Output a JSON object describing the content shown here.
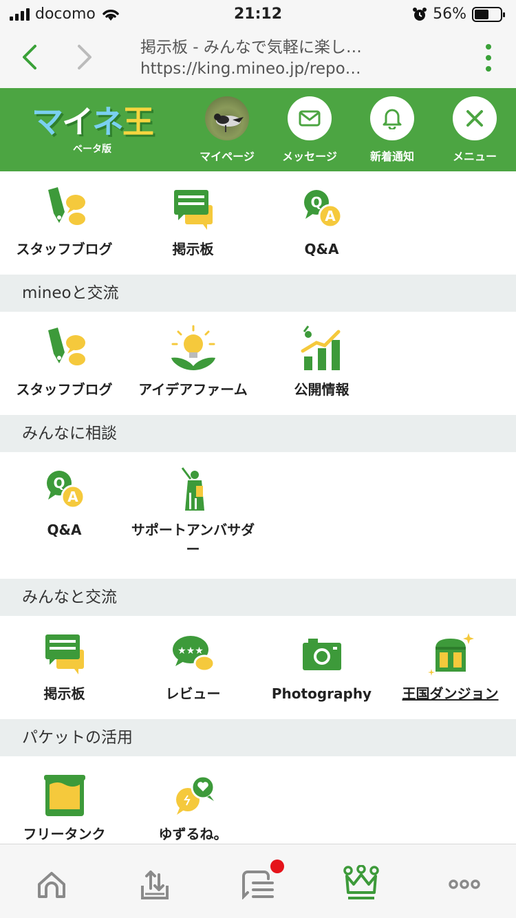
{
  "status_bar": {
    "carrier": "docomo",
    "time": "21:12",
    "battery": "56%"
  },
  "browser": {
    "page_title": "掲示板 - みんなで気軽に楽し…",
    "url": "https://king.mineo.jp/repo…"
  },
  "header": {
    "logo_text": [
      "マ",
      "イ",
      "ネ",
      "王"
    ],
    "beta_label": "ベータ版",
    "items": [
      {
        "label": "マイページ",
        "icon": "avatar"
      },
      {
        "label": "メッセージ",
        "icon": "envelope-icon"
      },
      {
        "label": "新着通知",
        "icon": "bell-icon"
      },
      {
        "label": "メニュー",
        "icon": "close-icon"
      }
    ]
  },
  "top_row": [
    {
      "label": "スタッフブログ",
      "icon": "staff-blog-icon"
    },
    {
      "label": "掲示板",
      "icon": "board-icon"
    },
    {
      "label": "Q&A",
      "icon": "qa-icon"
    }
  ],
  "sections": [
    {
      "title": "mineoと交流",
      "items": [
        {
          "label": "スタッフブログ",
          "icon": "staff-blog-icon"
        },
        {
          "label": "アイデアファーム",
          "icon": "idea-farm-icon"
        },
        {
          "label": "公開情報",
          "icon": "public-info-icon"
        }
      ]
    },
    {
      "title": "みんなに相談",
      "items": [
        {
          "label": "Q&A",
          "icon": "qa-icon"
        },
        {
          "label": "サポートアンバサダ\nー",
          "icon": "support-ambassador-icon"
        }
      ]
    },
    {
      "title": "みんなと交流",
      "items": [
        {
          "label": "掲示板",
          "icon": "board-icon"
        },
        {
          "label": "レビュー",
          "icon": "review-icon"
        },
        {
          "label": "Photography",
          "icon": "camera-icon"
        },
        {
          "label": "王国ダンジョン",
          "icon": "treasure-chest-icon"
        }
      ]
    },
    {
      "title": "パケットの活用",
      "items": [
        {
          "label": "フリータンク",
          "icon": "free-tank-icon"
        },
        {
          "label": "ゆずるね。",
          "icon": "yuzurune-icon"
        }
      ]
    }
  ],
  "tab_bar": [
    {
      "icon": "home-icon"
    },
    {
      "icon": "share-icon"
    },
    {
      "icon": "notes-icon",
      "badge": true
    },
    {
      "icon": "crown-icon",
      "active": true
    },
    {
      "icon": "more-icon"
    }
  ],
  "colors": {
    "brand_green": "#4ca542",
    "accent_yellow": "#f5c93c",
    "section_bg": "#eaeeee",
    "badge_red": "#e5141b"
  }
}
